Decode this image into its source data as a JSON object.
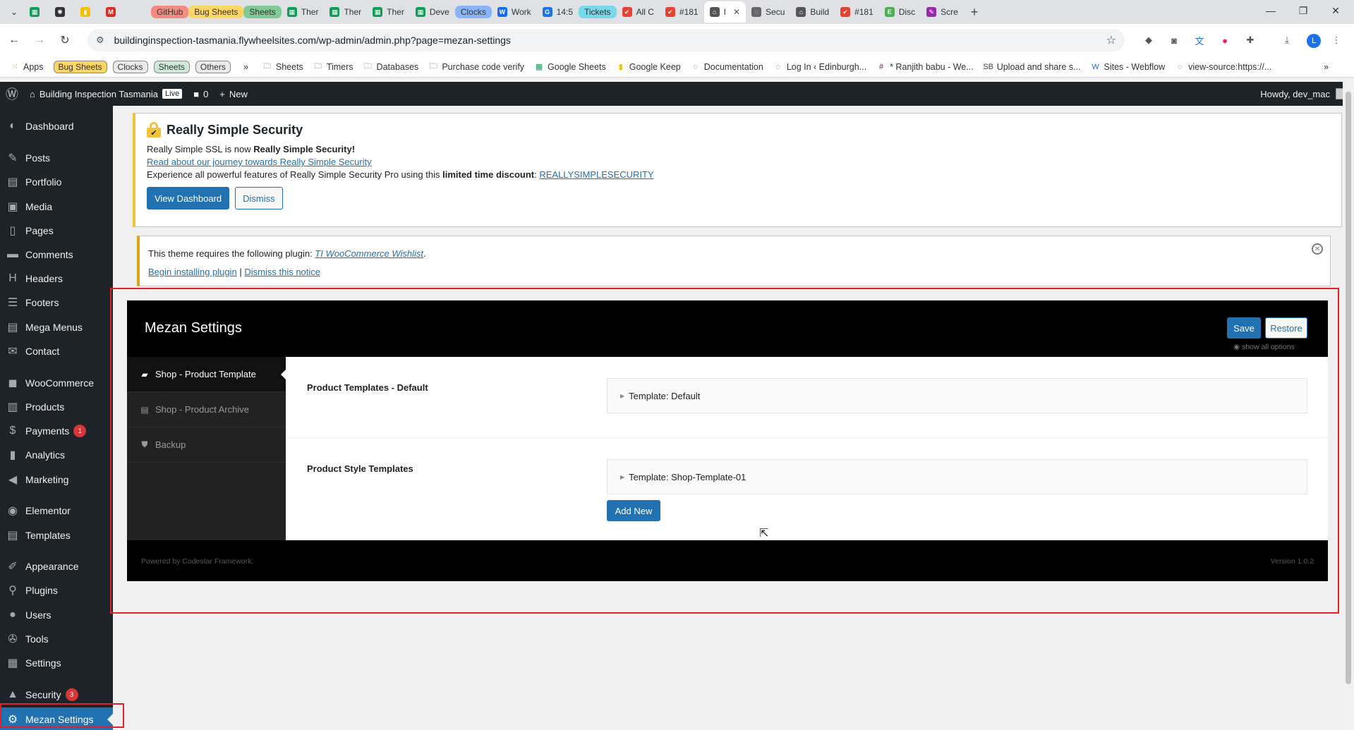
{
  "browser": {
    "tabs": [
      {
        "label": "",
        "favicon": "sheets-icon",
        "color": "#0f9d58"
      },
      {
        "label": "",
        "favicon": "openai-icon",
        "color": "#333333"
      },
      {
        "label": "",
        "favicon": "keep-icon",
        "color": "#fbbc04"
      },
      {
        "label": "",
        "favicon": "gmail-icon",
        "color": "#d93025"
      },
      {
        "label": "",
        "favicon": "blank-icon",
        "color": "#dfe1e5"
      },
      {
        "label": "GitHub",
        "pill": true,
        "pill_color": "#f28b82",
        "favicon": "github-icon"
      },
      {
        "label": "Bug Sheets",
        "pill": true,
        "pill_color": "#fdd663",
        "favicon": "sheets-icon"
      },
      {
        "label": "Sheets",
        "pill": true,
        "pill_color": "#81c995",
        "favicon": "sheets-icon"
      },
      {
        "label": "Ther",
        "favicon": "sheets-icon",
        "color": "#0f9d58"
      },
      {
        "label": "Ther",
        "favicon": "sheets-icon",
        "color": "#0f9d58"
      },
      {
        "label": "Ther",
        "favicon": "sheets-icon",
        "color": "#0f9d58"
      },
      {
        "label": "Deve",
        "favicon": "sheets-icon",
        "color": "#0f9d58"
      },
      {
        "label": "Clocks",
        "pill": true,
        "pill_color": "#8ab4f8",
        "favicon": "clock-icon"
      },
      {
        "label": "Work",
        "favicon": "webflow-icon",
        "color": "#146ef5"
      },
      {
        "label": "14:5",
        "favicon": "g-icon",
        "color": "#1a73e8"
      },
      {
        "label": "Tickets",
        "pill": true,
        "pill_color": "#78d9ec",
        "favicon": "ticket-icon"
      },
      {
        "label": "All C",
        "favicon": "todoist-icon",
        "color": "#e44332"
      },
      {
        "label": "#181",
        "favicon": "todoist-icon",
        "color": "#e44332"
      },
      {
        "label": "I",
        "favicon": "wp-site-icon",
        "color": "#555555",
        "active": true
      },
      {
        "label": "Secu",
        "favicon": "globe-icon",
        "color": "#666666"
      },
      {
        "label": "Build",
        "favicon": "wp-site-icon",
        "color": "#555555"
      },
      {
        "label": "#181",
        "favicon": "todoist-icon",
        "color": "#e44332"
      },
      {
        "label": "Disc",
        "favicon": "elementor-icon",
        "color": "#4caf50"
      },
      {
        "label": "Scre",
        "favicon": "pen-icon",
        "color": "#9c27b0"
      }
    ],
    "url": "buildinginspection-tasmania.flywheelsites.com/wp-admin/admin.php?page=mezan-settings",
    "profile_initial": "L",
    "bookmarks": [
      {
        "label": "Apps",
        "icon": "grid-icon",
        "type": "plain"
      },
      {
        "label": "Bug Sheets",
        "type": "pill",
        "bg": "#fdd663"
      },
      {
        "label": "Clocks",
        "type": "pill",
        "bg": "#e8eaed"
      },
      {
        "label": "Sheets",
        "type": "pill",
        "bg": "#ceead6"
      },
      {
        "label": "Others",
        "type": "pill",
        "bg": "#e8eaed"
      },
      {
        "label": "»",
        "type": "chevron"
      },
      {
        "label": "Sheets",
        "icon": "folder-icon",
        "type": "plain"
      },
      {
        "label": "Timers",
        "icon": "folder-icon",
        "type": "plain"
      },
      {
        "label": "Databases",
        "icon": "folder-icon",
        "type": "plain"
      },
      {
        "label": "Purchase code verify",
        "icon": "folder-icon",
        "type": "plain"
      },
      {
        "label": "Google Sheets",
        "icon": "sheets-icon",
        "type": "plain"
      },
      {
        "label": "Google Keep",
        "icon": "keep-icon",
        "type": "plain"
      },
      {
        "label": "Documentation",
        "icon": "globe-icon",
        "type": "plain"
      },
      {
        "label": "Log In ‹ Edinburgh...",
        "icon": "globe-icon",
        "type": "plain"
      },
      {
        "label": "* Ranjith babu - We...",
        "icon": "slack-icon",
        "type": "plain"
      },
      {
        "label": "Upload and share s...",
        "icon": "sb-icon",
        "type": "plain"
      },
      {
        "label": "Sites - Webflow",
        "icon": "webflow-icon",
        "type": "plain"
      },
      {
        "label": "view-source:https://...",
        "icon": "globe-icon",
        "type": "plain"
      }
    ]
  },
  "adminbar": {
    "site_name": "Building Inspection Tasmania",
    "live": "Live",
    "comments": "0",
    "new": "New",
    "howdy": "Howdy, dev_mac"
  },
  "sidebar": {
    "items": [
      {
        "label": "Dashboard",
        "icon": "dashboard-icon"
      },
      {
        "label": "Posts",
        "icon": "pin-icon"
      },
      {
        "label": "Portfolio",
        "icon": "portfolio-icon"
      },
      {
        "label": "Media",
        "icon": "media-icon"
      },
      {
        "label": "Pages",
        "icon": "pages-icon"
      },
      {
        "label": "Comments",
        "icon": "comment-icon"
      },
      {
        "label": "Headers",
        "icon": "header-icon"
      },
      {
        "label": "Footers",
        "icon": "footer-icon"
      },
      {
        "label": "Mega Menus",
        "icon": "menu-icon"
      },
      {
        "label": "Contact",
        "icon": "mail-icon"
      },
      {
        "label": "WooCommerce",
        "icon": "woo-icon"
      },
      {
        "label": "Products",
        "icon": "products-icon"
      },
      {
        "label": "Payments",
        "icon": "payments-icon",
        "badge": "1"
      },
      {
        "label": "Analytics",
        "icon": "analytics-icon"
      },
      {
        "label": "Marketing",
        "icon": "marketing-icon"
      },
      {
        "label": "Elementor",
        "icon": "elementor-icon"
      },
      {
        "label": "Templates",
        "icon": "templates-icon"
      },
      {
        "label": "Appearance",
        "icon": "appearance-icon"
      },
      {
        "label": "Plugins",
        "icon": "plugins-icon"
      },
      {
        "label": "Users",
        "icon": "users-icon"
      },
      {
        "label": "Tools",
        "icon": "tools-icon"
      },
      {
        "label": "Settings",
        "icon": "settings-icon"
      },
      {
        "label": "Security",
        "icon": "lock-icon",
        "badge": "3"
      },
      {
        "label": "Mezan Settings",
        "icon": "gear-icon",
        "current": true
      }
    ]
  },
  "rss_notice": {
    "title": "Really Simple Security",
    "line1_a": "Really Simple SSL is now ",
    "line1_b": "Really Simple Security!",
    "link": "Read about our journey towards Really Simple Security",
    "line3_a": "Experience all powerful features of Really Simple Security Pro using this ",
    "line3_b": "limited time discount",
    "line3_c": ": ",
    "coupon": "REALLYSIMPLESECURITY",
    "view_dashboard": "View Dashboard",
    "dismiss": "Dismiss"
  },
  "plugin_notice": {
    "text": "This theme requires the following plugin: ",
    "plugin": "TI WooCommerce Wishlist",
    "period": ".",
    "begin": "Begin installing plugin",
    "sep": " | ",
    "dismiss": "Dismiss this notice"
  },
  "mezan": {
    "title": "Mezan Settings",
    "save": "Save",
    "restore": "Restore",
    "show_all": "show all options",
    "nav": [
      {
        "label": "Shop - Product Template",
        "icon": "bag-icon",
        "active": true
      },
      {
        "label": "Shop - Product Archive",
        "icon": "basket-icon"
      },
      {
        "label": "Backup",
        "icon": "shield-icon"
      }
    ],
    "fields": [
      {
        "title": "Product Templates - Default",
        "accordion": "Template: Default"
      },
      {
        "title": "Product Style Templates",
        "accordion": "Template: Shop-Template-01",
        "add_new": "Add New"
      }
    ],
    "footer_left": "Powered by Codestar Framework.",
    "footer_right": "Version 1.0.2"
  }
}
